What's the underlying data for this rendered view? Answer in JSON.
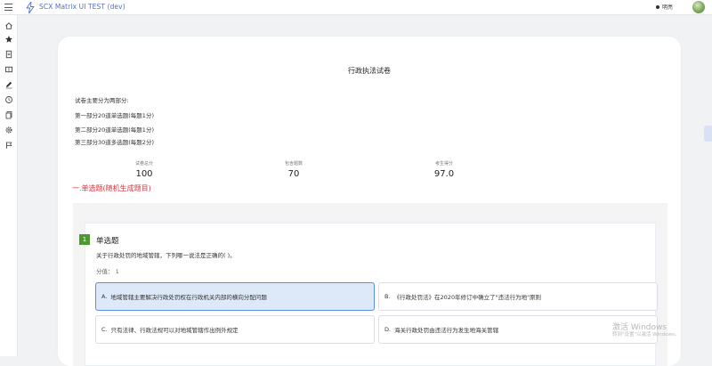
{
  "app": {
    "title": "SCX Matrix UI TEST (dev)",
    "theme_label": "明亮"
  },
  "sidebar": {
    "items": [
      {
        "icon": "home-icon"
      },
      {
        "icon": "star-icon"
      },
      {
        "icon": "document-icon"
      },
      {
        "icon": "book-icon"
      },
      {
        "icon": "edit-icon"
      },
      {
        "icon": "clock-icon"
      },
      {
        "icon": "copy-icon"
      },
      {
        "icon": "gear-icon"
      },
      {
        "icon": "flag-icon"
      }
    ]
  },
  "exam": {
    "title": "行政执法试卷",
    "intro": [
      "试卷主要分为两部分:",
      "第一部分20道单选题(每题1分)",
      "第二部分20道单选题(每题1分)",
      "第三部分30道多选题(每题2分)"
    ],
    "stats": [
      {
        "label": "试卷总分",
        "value": "100"
      },
      {
        "label": "包含题数",
        "value": "70"
      },
      {
        "label": "考生得分",
        "value": "97.0"
      }
    ],
    "section_heading": "一.单选题(随机生成题目)"
  },
  "question": {
    "number": "1",
    "type": "单选题",
    "text": "关于行政处罚的地域管辖，下列哪一说法是正确的(  )。",
    "score": "分值： 1",
    "options": [
      {
        "key": "A.",
        "text": "地域管辖主要解决行政处罚权在行政机关内部的横向分配问题",
        "selected": true
      },
      {
        "key": "B.",
        "text": "《行政处罚法》在2020年修订中确立了\"违法行为地\"原则",
        "selected": false
      },
      {
        "key": "C.",
        "text": "只有法律、行政法规可以对地域管辖作出例外规定",
        "selected": false
      },
      {
        "key": "D.",
        "text": "海关行政处罚由违法行为发生地海关管辖",
        "selected": false
      }
    ]
  },
  "watermark": {
    "title": "激活 Windows",
    "subtitle": "转到\"设置\"以激活 Windows。"
  },
  "colors": {
    "accent": "#4a6fd1",
    "section_red": "#e0333a",
    "question_badge": "#4a9a2e",
    "selected_bg": "#dde9f9"
  }
}
